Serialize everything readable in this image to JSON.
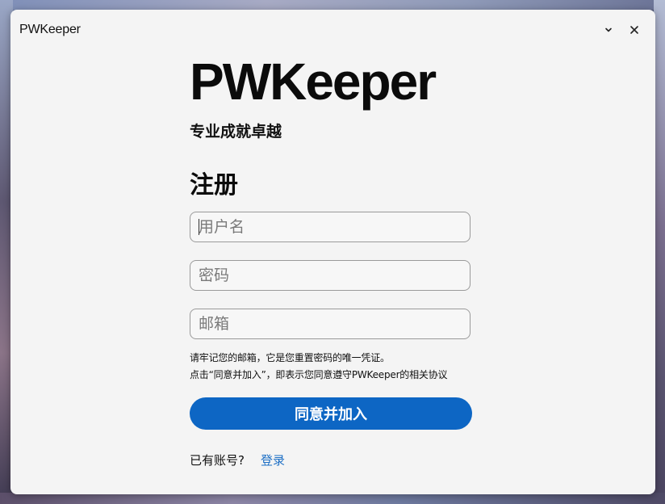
{
  "window": {
    "title": "PWKeeper",
    "minimize_icon": "chevron-down-icon",
    "close_icon": "close-icon"
  },
  "brand": {
    "name": "PWKeeper",
    "tagline": "专业成就卓越"
  },
  "form": {
    "heading": "注册",
    "username_placeholder": "用户名",
    "password_placeholder": "密码",
    "email_placeholder": "邮箱",
    "note_line1": "请牢记您的邮箱，它是您重置密码的唯一凭证。",
    "note_line2": "点击“同意并加入”，即表示您同意遵守PWKeeper的相关协议",
    "submit_label": "同意并加入"
  },
  "footer": {
    "have_account": "已有账号?",
    "login_label": "登录"
  },
  "colors": {
    "accent": "#0d66c4",
    "link": "#1d6fc5",
    "window_bg": "#f4f4f4"
  }
}
